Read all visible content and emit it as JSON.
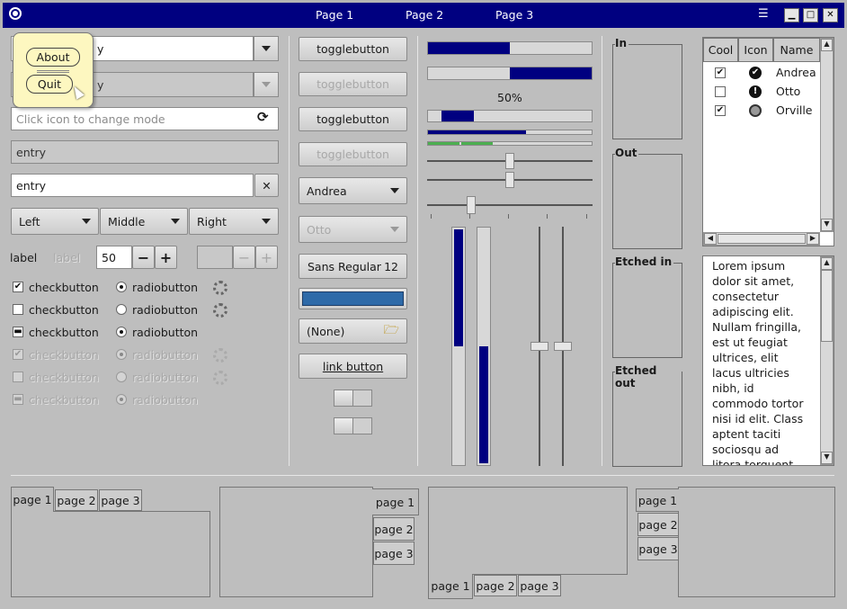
{
  "window": {
    "tabs": [
      "Page 1",
      "Page 2",
      "Page 3"
    ],
    "menu_icon": "hamburger-icon",
    "controls": [
      "minimize",
      "maximize",
      "close"
    ]
  },
  "popup_menu": {
    "about": "About",
    "quit": "Quit"
  },
  "left_column": {
    "combo1_value": "y",
    "combo2_value": "y",
    "mode_entry_placeholder": "Click icon to change mode",
    "entry_disabled": "entry",
    "entry_clear": "entry",
    "dropdowns": [
      "Left",
      "Middle",
      "Right"
    ],
    "label_enabled": "label",
    "label_disabled": "label",
    "spin_value": "50",
    "spin_value_disabled": "",
    "checkbuttons": [
      {
        "label": "checkbutton",
        "state": "checked",
        "disabled": false
      },
      {
        "label": "checkbutton",
        "state": "unchecked",
        "disabled": false
      },
      {
        "label": "checkbutton",
        "state": "inconsistent",
        "disabled": false
      },
      {
        "label": "checkbutton",
        "state": "checked",
        "disabled": true
      },
      {
        "label": "checkbutton",
        "state": "unchecked",
        "disabled": true
      },
      {
        "label": "checkbutton",
        "state": "inconsistent",
        "disabled": true
      }
    ],
    "radiobuttons": [
      {
        "label": "radiobutton",
        "selected": true,
        "disabled": false
      },
      {
        "label": "radiobutton",
        "selected": false,
        "disabled": false
      },
      {
        "label": "radiobutton",
        "selected": true,
        "disabled": false
      },
      {
        "label": "radiobutton",
        "selected": true,
        "disabled": true
      },
      {
        "label": "radiobutton",
        "selected": false,
        "disabled": true
      },
      {
        "label": "radiobutton",
        "selected": true,
        "disabled": true
      }
    ]
  },
  "middle_column": {
    "togglebuttons": [
      "togglebutton",
      "togglebutton",
      "togglebutton",
      "togglebutton"
    ],
    "combo_andrea": "Andrea",
    "combo_otto": "Otto",
    "font_button": {
      "family": "Sans Regular",
      "size": "12"
    },
    "file_chooser": "(None)",
    "link_button": "link button"
  },
  "progress": {
    "bar1": 0.5,
    "bar2": 0.5,
    "bar2_text": "50%",
    "bar3": 0.2,
    "bar4": 0.6,
    "scale1": 0.5,
    "scale2": 0.5,
    "scale3": 0.25
  },
  "vertical": {
    "progress1": 0.5,
    "progress2": 0.5,
    "scale1": 0.5,
    "scale2": 0.5
  },
  "frames": [
    "In",
    "Out",
    "Etched in",
    "Etched out"
  ],
  "tree": {
    "columns": [
      "Cool",
      "Icon",
      "Name"
    ],
    "rows": [
      {
        "cool": true,
        "icon": "check-circle-icon",
        "name": "Andrea"
      },
      {
        "cool": false,
        "icon": "alert-circle-icon",
        "name": "Otto"
      },
      {
        "cool": true,
        "icon": "gray-circle-icon",
        "name": "Orville"
      }
    ]
  },
  "textview": "Lorem ipsum dolor sit amet, consectetur adipiscing elit. Nullam fringilla, est ut feugiat ultrices, elit lacus ultricies nibh, id commodo tortor nisi id elit. Class aptent taciti sociosqu ad litora torquent per conubia nostra,",
  "notebooks": {
    "tabs": [
      "page 1",
      "page 2",
      "page 3"
    ]
  },
  "colors": {
    "titlebar": "#000080",
    "progress": "#000080",
    "bg": "#bebebe",
    "color_button": "#2e6aa8",
    "green": "#4caf50"
  }
}
